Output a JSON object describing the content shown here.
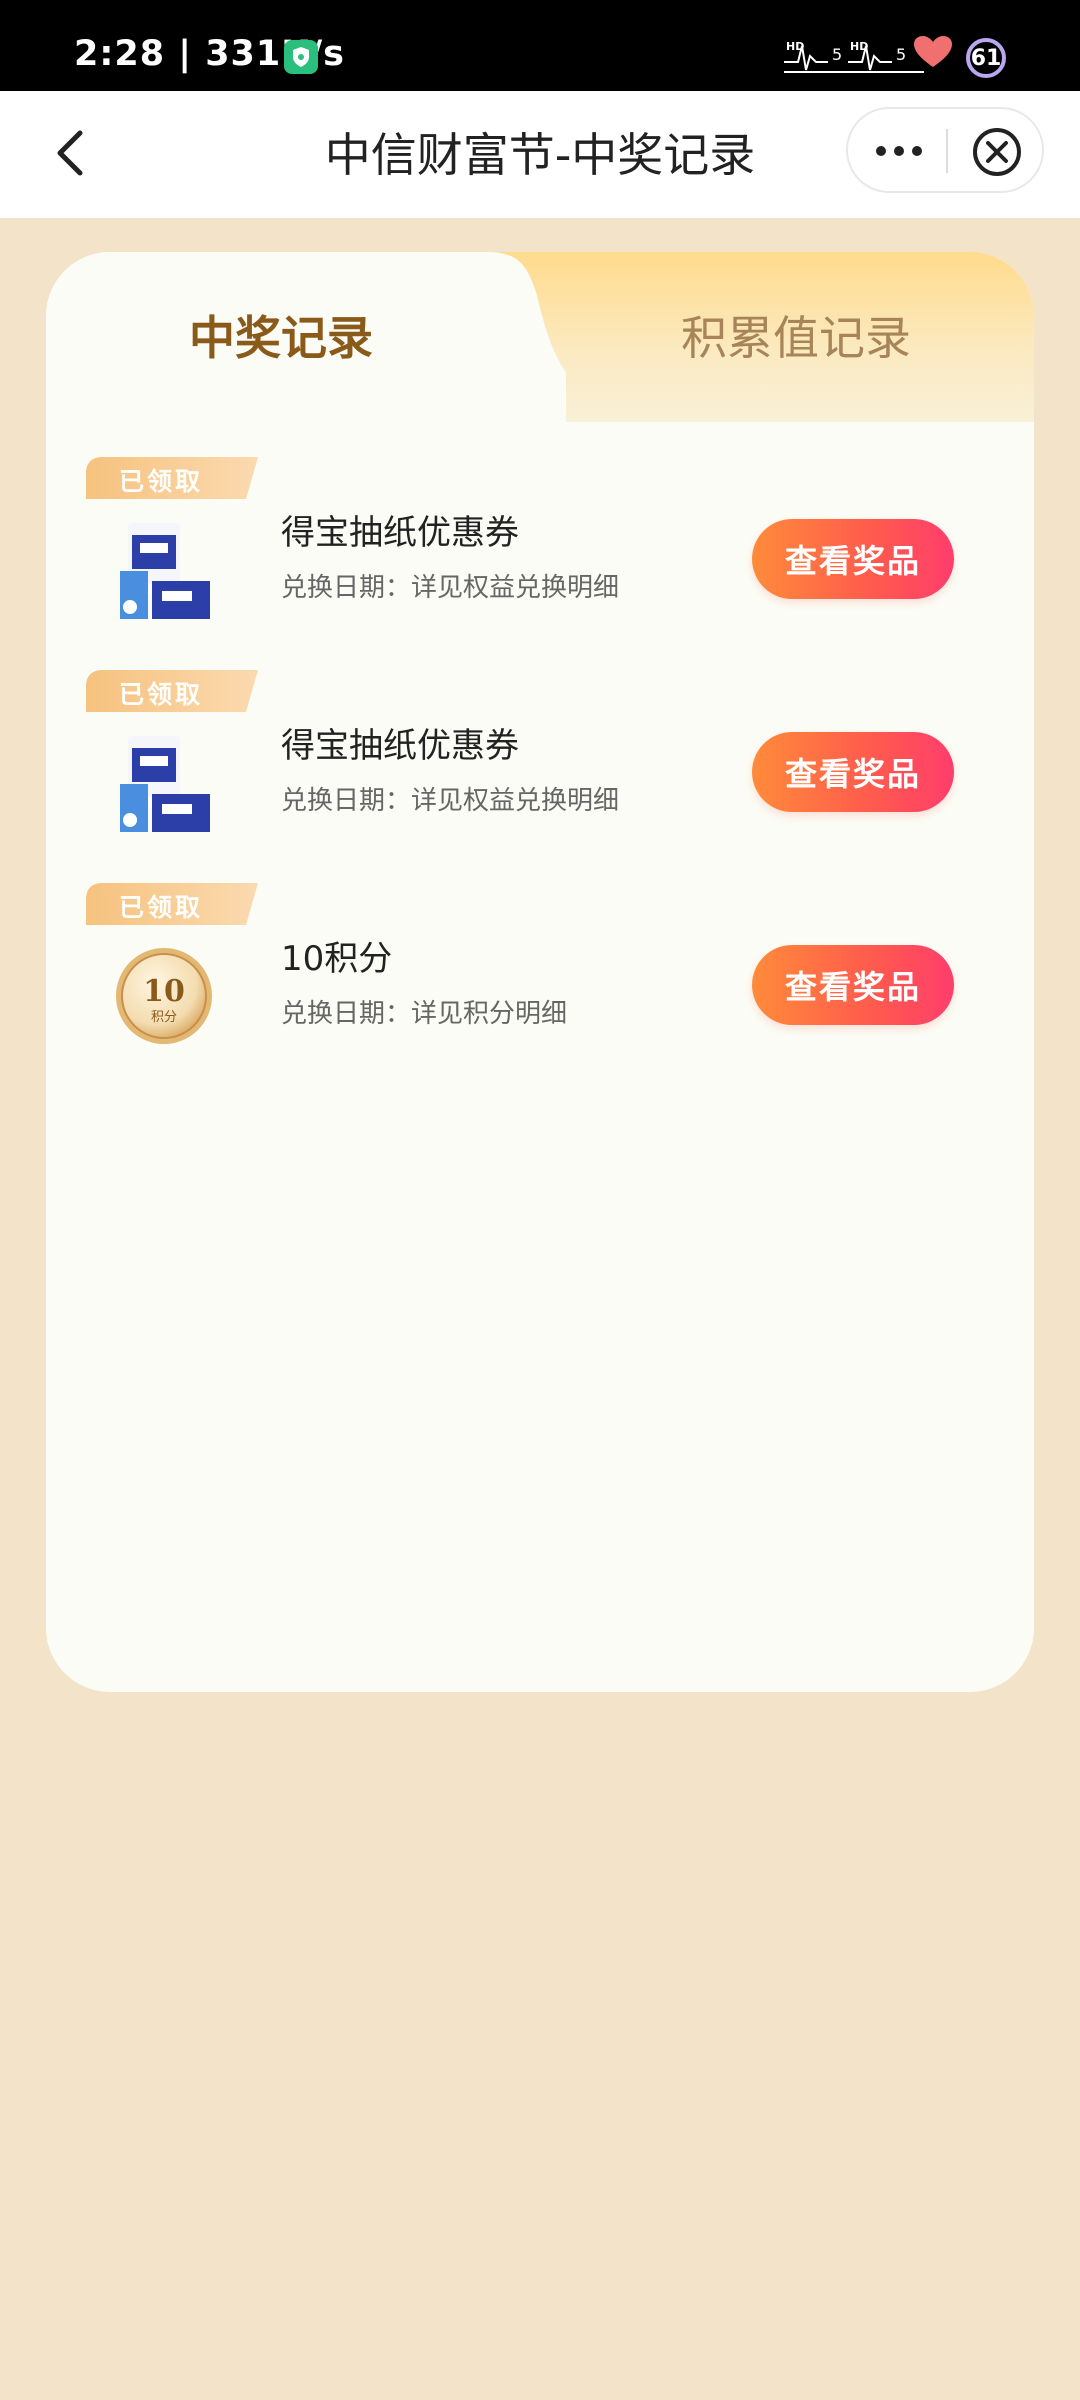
{
  "status_bar": {
    "time": "2:28 | 331K/s",
    "battery": "61",
    "icons": [
      "shield-check-icon",
      "signal-hd-icon",
      "heart-icon",
      "battery-icon"
    ]
  },
  "header": {
    "title": "中信财富节-中奖记录",
    "back_icon": "chevron-left-icon",
    "more_icon": "more-dots-icon",
    "close_icon": "close-circle-icon"
  },
  "tabs": [
    {
      "label": "中奖记录",
      "active": true
    },
    {
      "label": "积累值记录",
      "active": false
    }
  ],
  "records": [
    {
      "status": "已领取",
      "title": "得宝抽纸优惠券",
      "subtitle": "兑换日期：详见权益兑换明细",
      "button": "查看奖品",
      "thumbnail": "tissue-pack-image"
    },
    {
      "status": "已领取",
      "title": "得宝抽纸优惠券",
      "subtitle": "兑换日期：详见权益兑换明细",
      "button": "查看奖品",
      "thumbnail": "tissue-pack-image"
    },
    {
      "status": "已领取",
      "title": "10积分",
      "subtitle": "兑换日期：详见积分明细",
      "button": "查看奖品",
      "thumbnail": "points-coin-image",
      "coin": {
        "value": "10",
        "label": "积分"
      }
    }
  ],
  "colors": {
    "page_bg": "#f3e4c9",
    "card_bg": "#fbfcf5",
    "tab_active_text": "#8a5a1a",
    "button_gradient_start": "#ff8b3a",
    "button_gradient_end": "#ff3d6c"
  }
}
